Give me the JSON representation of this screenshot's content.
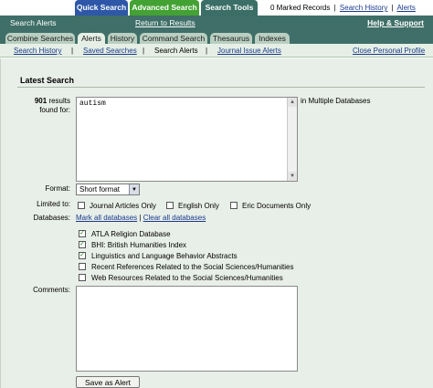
{
  "top_tabs": [
    "Quick Search",
    "Advanced Search",
    "Search Tools"
  ],
  "top_right": {
    "marked_records": "0 Marked Records",
    "sep": "|",
    "search_history": "Search History",
    "alerts": "Alerts"
  },
  "header": {
    "title": "Search Alerts",
    "return_link": "Return to Results",
    "help": "Help & Support"
  },
  "sub_tabs": [
    "Combine Searches",
    "Alerts",
    "History",
    "Command Search",
    "Thesaurus",
    "Indexes"
  ],
  "link_row": {
    "search_history": "Search History",
    "saved_searches": "Saved Searches",
    "search_alerts": "Search Alerts",
    "journal_issue_alerts": "Journal Issue Alerts",
    "close_profile": "Close Personal Profile",
    "sep": "|"
  },
  "latest_search": {
    "title": "Latest Search",
    "result_count": "901",
    "results_label_1": "results",
    "results_label_2": "found for:",
    "query": "autism",
    "in_label": "in Multiple Databases"
  },
  "format": {
    "label": "Format:",
    "selected": "Short format"
  },
  "limited_to": {
    "label": "Limited to:",
    "options": [
      {
        "label": "Journal Articles Only",
        "checked": false
      },
      {
        "label": "English Only",
        "checked": false
      },
      {
        "label": "Eric Documents Only",
        "checked": false
      }
    ]
  },
  "databases": {
    "label": "Databases:",
    "mark_all": "Mark all databases",
    "sep": "|",
    "clear_all": "Clear all databases",
    "items": [
      {
        "label": "ATLA Religion Database",
        "checked": true
      },
      {
        "label": "BHI: British Humanities Index",
        "checked": true
      },
      {
        "label": "Linguistics and Language Behavior Abstracts",
        "checked": true
      },
      {
        "label": "Recent References Related to the Social Sciences/Humanities",
        "checked": false
      },
      {
        "label": "Web Resources Related to the Social Sciences/Humanities",
        "checked": false
      }
    ]
  },
  "comments": {
    "label": "Comments:",
    "value": ""
  },
  "save_button": "Save as Alert"
}
